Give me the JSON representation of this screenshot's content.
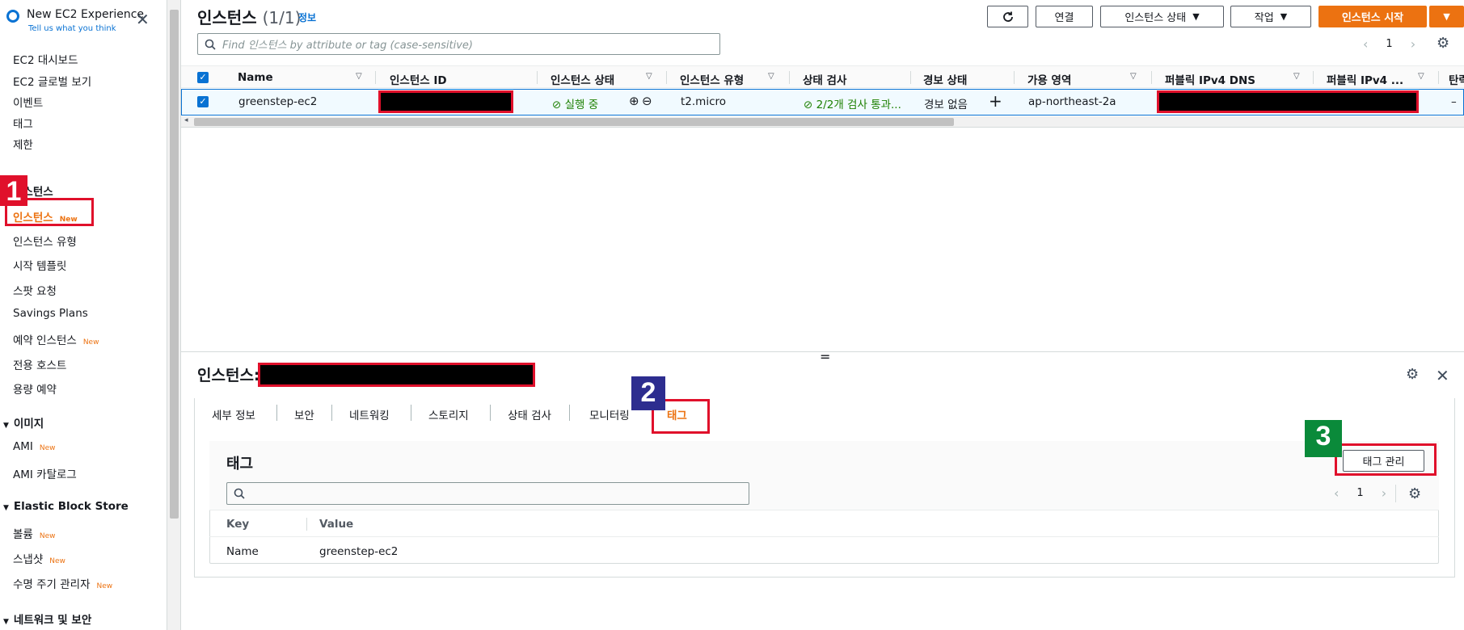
{
  "sidebar": {
    "toggle_title": "New EC2 Experience",
    "toggle_sub": "Tell us what you think",
    "new_label": "New",
    "items": [
      {
        "label": "EC2 대시보드"
      },
      {
        "label": "EC2 글로벌 보기"
      },
      {
        "label": "이벤트"
      },
      {
        "label": "태그"
      },
      {
        "label": "제한"
      }
    ],
    "section_instances": "인스턴스",
    "instances_items": [
      {
        "label": "인스턴스"
      },
      {
        "label": "인스턴스 유형"
      },
      {
        "label": "시작 템플릿"
      },
      {
        "label": "스팟 요청"
      },
      {
        "label": "Savings Plans"
      },
      {
        "label": "예약 인스턴스"
      },
      {
        "label": "전용 호스트"
      },
      {
        "label": "용량 예약"
      }
    ],
    "section_images": "이미지",
    "images_items": [
      {
        "label": "AMI"
      },
      {
        "label": "AMI 카탈로그"
      }
    ],
    "section_ebs": "Elastic Block Store",
    "ebs_items": [
      {
        "label": "볼륨"
      },
      {
        "label": "스냅샷"
      },
      {
        "label": "수명 주기 관리자"
      }
    ],
    "section_network": "네트워크 및 보안"
  },
  "header": {
    "title": "인스턴스",
    "count": "(1/1)",
    "info": "정보",
    "connect": "연결",
    "instance_state": "인스턴스 상태",
    "actions": "작업",
    "launch": "인스턴스 시작",
    "search_placeholder": "Find 인스턴스 by attribute or tag (case-sensitive)",
    "page": "1"
  },
  "table": {
    "columns": [
      "Name",
      "인스턴스 ID",
      "인스턴스 상태",
      "인스턴스 유형",
      "상태 검사",
      "경보 상태",
      "가용 영역",
      "퍼블릭 IPv4 DNS",
      "퍼블릭 IPv4 ...",
      "탄력"
    ],
    "row": {
      "name": "greenstep-ec2",
      "state": "실행 중",
      "type": "t2.micro",
      "status_check": "2/2개 검사 통과...",
      "alarm": "경보 없음",
      "az": "ap-northeast-2a",
      "elastic": "–"
    }
  },
  "details": {
    "title": "인스턴스:",
    "tabs": [
      "세부 정보",
      "보안",
      "네트워킹",
      "스토리지",
      "상태 검사",
      "모니터링",
      "태그"
    ],
    "tags_title": "태그",
    "manage_tags": "태그 관리",
    "page": "1",
    "cols": [
      "Key",
      "Value"
    ],
    "rows": [
      {
        "key": "Name",
        "value": "greenstep-ec2"
      }
    ]
  },
  "annotations": [
    "1",
    "2",
    "3"
  ],
  "colors": {
    "accent": "#ec7211",
    "link": "#0972d3",
    "annotation_red": "#e0102b",
    "badge1": "#e0102b",
    "badge2": "#2d2d8f",
    "badge3": "#0a8a3a"
  }
}
